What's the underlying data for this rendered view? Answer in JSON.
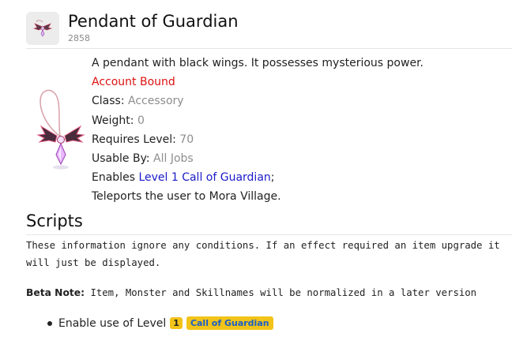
{
  "item": {
    "name": "Pendant of Guardian",
    "id": "2858",
    "image_icon": "winged-pendant-icon"
  },
  "details": {
    "description": "A pendant with black wings. It possesses mysterious power.",
    "bound": "Account Bound",
    "class_label": "Class:",
    "class_value": "Accessory",
    "weight_label": "Weight:",
    "weight_value": "0",
    "level_label": "Requires Level:",
    "level_value": "70",
    "usable_label": "Usable By:",
    "usable_value": "All Jobs",
    "enables_prefix": "Enables",
    "enables_link": "Level 1 Call of Guardian",
    "enables_suffix": ";",
    "teleport": "Teleports the user to Mora Village."
  },
  "scripts": {
    "heading": "Scripts",
    "info": "These information ignore any conditions. If an effect required an item upgrade it will just be displayed.",
    "beta_label": "Beta Note:",
    "beta_text": " Item, Monster and Skillnames will be normalized in a later version",
    "effects": [
      {
        "prefix": "Enable use of Level",
        "level": "1",
        "skill": "Call of Guardian"
      }
    ]
  },
  "colors": {
    "bound": "#dd1111",
    "link": "#1a1ac8",
    "muted": "#8d8d8d",
    "badge_bg": "#f2c318",
    "skill_text": "#1a5fc8"
  }
}
